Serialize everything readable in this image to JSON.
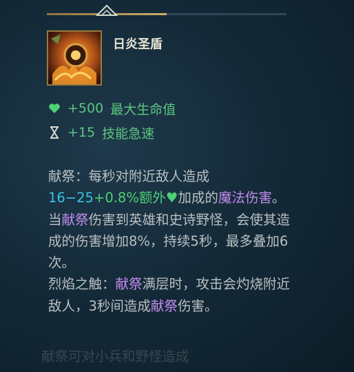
{
  "item": {
    "name": "日炎圣盾"
  },
  "stats": [
    {
      "icon": "heart-icon",
      "value": "+500",
      "label": "最大生命值"
    },
    {
      "icon": "hourglass-icon",
      "value": "+15",
      "label": "技能急速"
    }
  ],
  "description": {
    "p1_label": "献祭：",
    "p1_text": "每秒对附近敌人造成",
    "dmg_base": "16−25",
    "plus": "+",
    "dmg_scale": "0.8%额外",
    "scale_suffix": "加成的",
    "magic_damage": "魔法伤害",
    "p1_b": "。当",
    "immolate_ref1": "献祭",
    "p1_c": "伤害到英雄和史诗野怪，会使其造成的伤害增加8%，持续5秒，最多叠加6次。",
    "p2_label": "烈焰之触：",
    "immolate_ref2": "献祭",
    "p2_a": "满层时，攻击会灼烧附近敌人，3秒间造成",
    "immolate_ref3": "献祭",
    "p2_b": "伤害。",
    "p3_fade": "献祭可对小兵和野怪造成"
  },
  "colors": {
    "stat_green": "#5bc77f",
    "ability_blue": "#38c4e6",
    "keyword_purple": "#c48bf0",
    "text_gray": "#b9c0c2"
  }
}
